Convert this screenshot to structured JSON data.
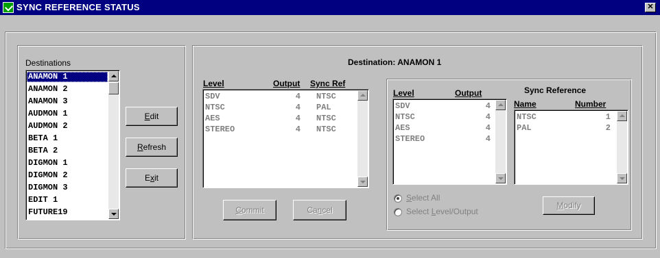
{
  "window": {
    "title": "SYNC REFERENCE STATUS",
    "close_glyph": "✕",
    "icon": "app-check-icon"
  },
  "destinations": {
    "label": "Destinations",
    "items": [
      "ANAMON 1",
      "ANAMON 2",
      "ANAMON 3",
      "AUDMON 1",
      "AUDMON 2",
      "BETA 1",
      "BETA 2",
      "DIGMON 1",
      "DIGMON 2",
      "DIGMON 3",
      "EDIT 1",
      "FUTURE19"
    ],
    "selected": "ANAMON 1"
  },
  "buttons": {
    "edit_pre": "",
    "edit_key": "E",
    "edit_post": "dit",
    "refresh_pre": "",
    "refresh_key": "R",
    "refresh_post": "efresh",
    "exit_pre": "E",
    "exit_key": "x",
    "exit_post": "it",
    "commit_pre": "",
    "commit_key": "C",
    "commit_post": "ommit",
    "cancel_pre": "Ca",
    "cancel_key": "n",
    "cancel_post": "cel",
    "modify_pre": "",
    "modify_key": "M",
    "modify_post": "odify"
  },
  "detail": {
    "destination_label": "Destination:",
    "destination_value": "ANAMON 1"
  },
  "level_table": {
    "headers": {
      "level": "Level",
      "output": "Output",
      "sync_ref": "Sync Ref"
    },
    "rows": [
      {
        "level": "SDV",
        "output": "4",
        "sync_ref": "NTSC"
      },
      {
        "level": "NTSC",
        "output": "4",
        "sync_ref": "PAL"
      },
      {
        "level": "AES",
        "output": "4",
        "sync_ref": "NTSC"
      },
      {
        "level": "STEREO",
        "output": "4",
        "sync_ref": "NTSC"
      }
    ]
  },
  "edit_levels": {
    "headers": {
      "level": "Level",
      "output": "Output"
    },
    "rows": [
      {
        "level": "SDV",
        "output": "4"
      },
      {
        "level": "NTSC",
        "output": "4"
      },
      {
        "level": "AES",
        "output": "4"
      },
      {
        "level": "STEREO",
        "output": "4"
      }
    ]
  },
  "sync_reference": {
    "title": "Sync Reference",
    "headers": {
      "name": "Name",
      "number": "Number"
    },
    "rows": [
      {
        "name": "NTSC",
        "number": "1"
      },
      {
        "name": "PAL",
        "number": "2"
      }
    ]
  },
  "radios": {
    "select_all_pre": "",
    "select_all_key": "S",
    "select_all_post": "elect All",
    "select_level_pre": "Select ",
    "select_level_key": "L",
    "select_level_post": "evel/Output",
    "selected": "select_all"
  },
  "colors": {
    "titlebar": "#000080",
    "window_bg": "#c0c0c0",
    "selection": "#000080",
    "disabled_text": "#808080"
  }
}
